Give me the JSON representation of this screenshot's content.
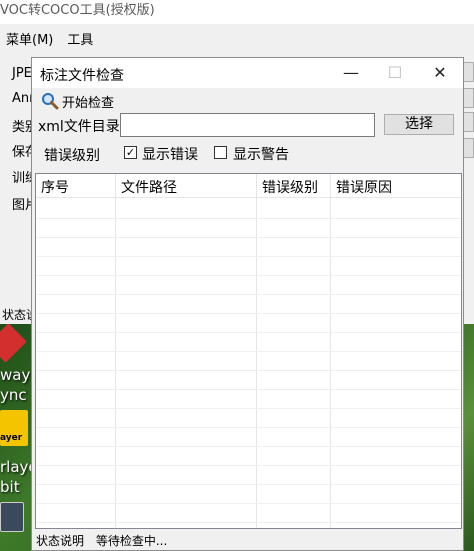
{
  "background_window": {
    "title": "VOC转COCO工具(授权版)",
    "menu": [
      "菜单(M)",
      "工具"
    ],
    "labels": [
      "JPE",
      "Ann",
      "类别",
      "保存",
      "训练",
      "图片"
    ],
    "status_label": "状态说"
  },
  "desktop": {
    "labels": [
      "way",
      "ync",
      "rlaye",
      "bit"
    ],
    "icon_text": "ayer"
  },
  "dialog": {
    "title": "标注文件检查",
    "controls": {
      "minimize": "—",
      "maximize": "☐",
      "close": "✕"
    },
    "start_check_label": "开始检查",
    "dir_label": "xml文件目录",
    "dir_value": "",
    "choose_button": "选择",
    "error_level_label": "错误级别",
    "show_errors_label": "显示错误",
    "show_errors_checked": true,
    "show_warnings_label": "显示警告",
    "show_warnings_checked": false,
    "table_columns": [
      "序号",
      "文件路径",
      "错误级别",
      "错误原因"
    ],
    "status_label": "状态说明",
    "status_text": "等待检查中..."
  },
  "colors": {
    "accent_desktop_icon_red": "#d32f2f",
    "accent_desktop_icon_yellow": "#f5c400",
    "window_bg": "#f0f0f0"
  }
}
